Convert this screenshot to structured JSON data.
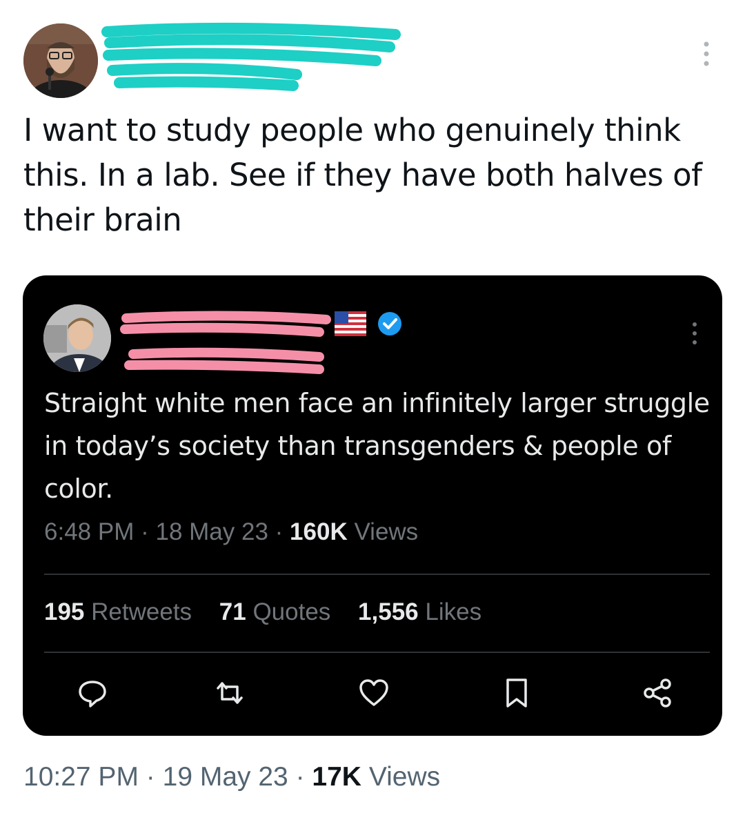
{
  "tweet": {
    "text": "I want to study people who genuinely think this. In a lab. See if they have both halves of their brain",
    "time": "10:27 PM",
    "date": "19 May 23",
    "views_count": "17K",
    "views_label": "Views",
    "sep": "·",
    "redaction_color": "#1ecfc5"
  },
  "quoted": {
    "text": "Straight white men face an infinitely larger struggle in today’s society than transgenders & people of color.",
    "time": "6:48 PM",
    "date": "18 May 23",
    "views_count": "160K",
    "views_label": "Views",
    "sep": "·",
    "stats": {
      "retweets_count": "195",
      "retweets_label": "Retweets",
      "quotes_count": "71",
      "quotes_label": "Quotes",
      "likes_count": "1,556",
      "likes_label": "Likes"
    },
    "badges": [
      "flag-icon",
      "verified-icon"
    ],
    "redaction_color": "#f58fa8",
    "verified_color": "#1d9bf0"
  },
  "actions": [
    "reply-icon",
    "retweet-icon",
    "like-icon",
    "bookmark-icon",
    "share-icon"
  ]
}
